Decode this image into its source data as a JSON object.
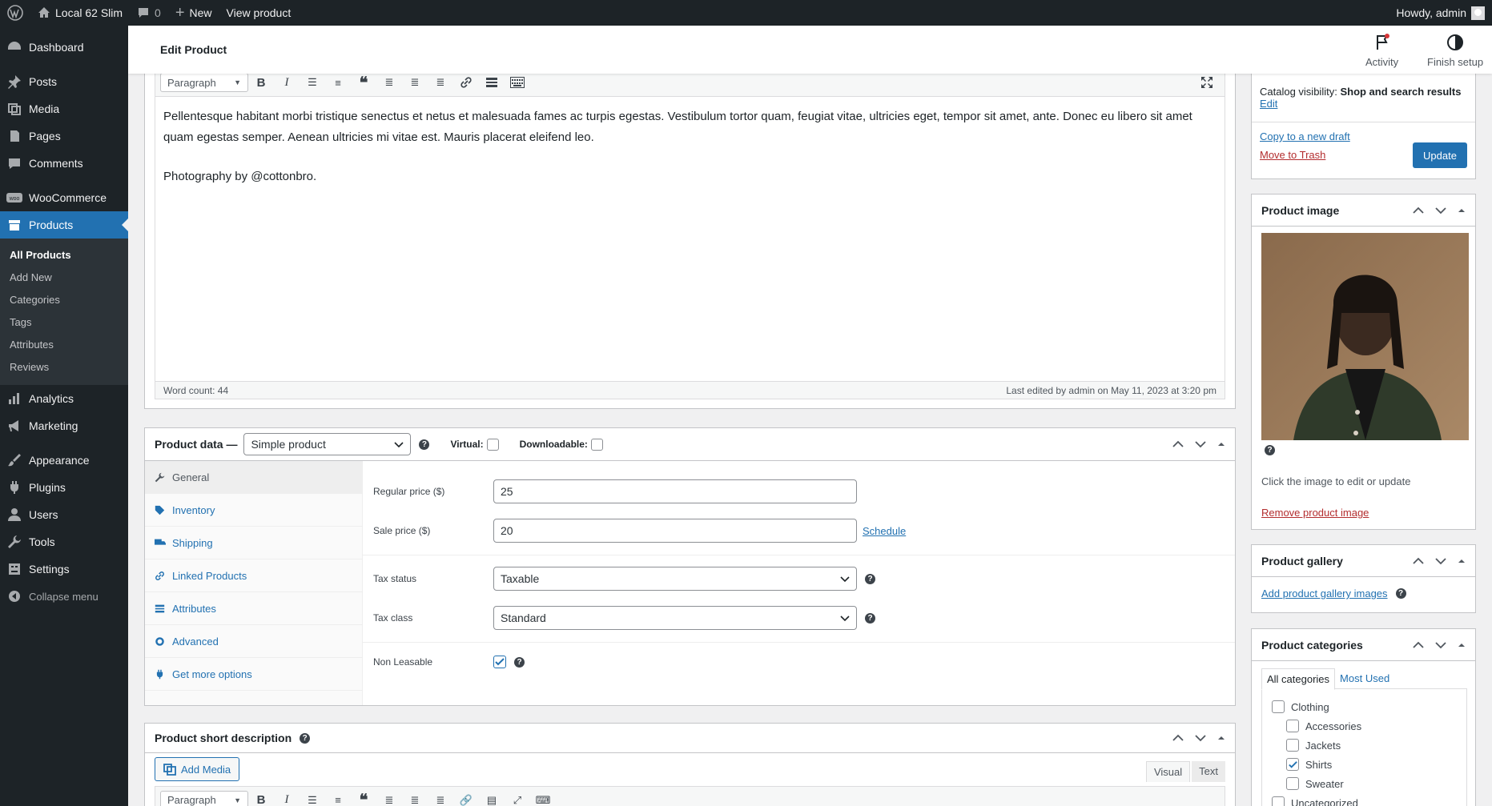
{
  "admin_bar": {
    "site_name": "Local 62 Slim",
    "comments_count": "0",
    "new_label": "New",
    "view_label": "View product",
    "howdy": "Howdy, admin"
  },
  "sidebar": {
    "items": [
      {
        "label": "Dashboard",
        "icon": "dashboard-icon"
      },
      {
        "label": "Posts",
        "icon": "pin-icon"
      },
      {
        "label": "Media",
        "icon": "media-icon"
      },
      {
        "label": "Pages",
        "icon": "page-icon"
      },
      {
        "label": "Comments",
        "icon": "comment-icon"
      },
      {
        "label": "WooCommerce",
        "icon": "woo-icon"
      },
      {
        "label": "Products",
        "icon": "archive-icon"
      },
      {
        "label": "Analytics",
        "icon": "bar-chart-icon"
      },
      {
        "label": "Marketing",
        "icon": "megaphone-icon"
      },
      {
        "label": "Appearance",
        "icon": "brush-icon"
      },
      {
        "label": "Plugins",
        "icon": "plugin-icon"
      },
      {
        "label": "Users",
        "icon": "user-icon"
      },
      {
        "label": "Tools",
        "icon": "wrench-icon"
      },
      {
        "label": "Settings",
        "icon": "settings-icon"
      },
      {
        "label": "Collapse menu",
        "icon": "collapse-icon"
      }
    ],
    "submenu": [
      "All Products",
      "Add New",
      "Categories",
      "Tags",
      "Attributes",
      "Reviews"
    ]
  },
  "header": {
    "title": "Edit Product",
    "activity": "Activity",
    "finish_setup": "Finish setup"
  },
  "editor": {
    "format": "Paragraph",
    "paragraph1": "Pellentesque habitant morbi tristique senectus et netus et malesuada fames ac turpis egestas. Vestibulum tortor quam, feugiat vitae, ultricies eget, tempor sit amet, ante. Donec eu libero sit amet quam egestas semper. Aenean ultricies mi vitae est. Mauris placerat eleifend leo.",
    "paragraph2": "Photography by @cottonbro.",
    "word_count": "Word count: 44",
    "last_edited": "Last edited by admin on May 11, 2023 at 3:20 pm"
  },
  "product_data": {
    "title": "Product data —",
    "type": "Simple product",
    "virtual_label": "Virtual:",
    "downloadable_label": "Downloadable:",
    "tabs": [
      "General",
      "Inventory",
      "Shipping",
      "Linked Products",
      "Attributes",
      "Advanced",
      "Get more options"
    ],
    "regular_price_label": "Regular price ($)",
    "regular_price": "25",
    "sale_price_label": "Sale price ($)",
    "sale_price": "20",
    "schedule": "Schedule",
    "tax_status_label": "Tax status",
    "tax_status": "Taxable",
    "tax_class_label": "Tax class",
    "tax_class": "Standard",
    "non_leasable_label": "Non Leasable",
    "non_leasable": true
  },
  "short_desc": {
    "title": "Product short description",
    "add_media": "Add Media",
    "visual": "Visual",
    "text": "Text",
    "format": "Paragraph"
  },
  "publish": {
    "catalog_visibility_label": "Catalog visibility:",
    "catalog_visibility": "Shop and search results",
    "edit": "Edit",
    "copy_draft": "Copy to a new draft",
    "trash": "Move to Trash",
    "update": "Update"
  },
  "product_image": {
    "title": "Product image",
    "hint": "Click the image to edit or update",
    "remove": "Remove product image"
  },
  "gallery": {
    "title": "Product gallery",
    "add": "Add product gallery images"
  },
  "categories": {
    "title": "Product categories",
    "tab_all": "All categories",
    "tab_used": "Most Used",
    "items": [
      {
        "label": "Clothing",
        "checked": false,
        "child": false
      },
      {
        "label": "Accessories",
        "checked": false,
        "child": true
      },
      {
        "label": "Jackets",
        "checked": false,
        "child": true
      },
      {
        "label": "Shirts",
        "checked": true,
        "child": true
      },
      {
        "label": "Sweater",
        "checked": false,
        "child": true
      },
      {
        "label": "Uncategorized",
        "checked": false,
        "child": false
      }
    ]
  },
  "colors": {
    "accent": "#2271b1",
    "sidebar": "#1d2327",
    "trash": "#b32d2e"
  }
}
